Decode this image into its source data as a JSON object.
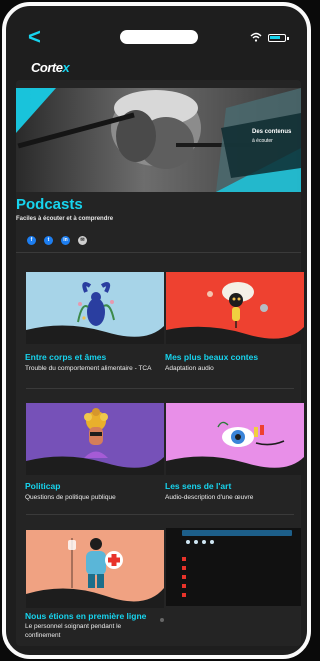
{
  "app": {
    "logo_main": "Corte",
    "logo_accent": "x"
  },
  "hero": {
    "title": "Des contenus",
    "subtitle": "à écouter"
  },
  "page": {
    "title": "Podcasts",
    "subtitle": "Faciles à écouter et à comprendre",
    "share": [
      {
        "icon": "facebook-icon",
        "glyph": "f"
      },
      {
        "icon": "twitter-icon",
        "glyph": "t"
      },
      {
        "icon": "linkedin-icon",
        "glyph": "in"
      },
      {
        "icon": "email-icon",
        "glyph": "✉"
      }
    ]
  },
  "podcasts": [
    {
      "title": "Entre corps et âmes",
      "desc": "Trouble du comportement alimentaire - TCA"
    },
    {
      "title": "Mes plus beaux contes",
      "desc": "Adaptation audio"
    },
    {
      "title": "Politicap",
      "desc": "Questions de politique publique"
    },
    {
      "title": "Les sens de l'art",
      "desc": "Audio-description d'une œuvre"
    },
    {
      "title": "Nous étions en première ligne",
      "desc": "Le personnel soignant pendant le confinement"
    }
  ],
  "colors": {
    "accent": "#17d4ee",
    "background": "#1e1e1e"
  }
}
